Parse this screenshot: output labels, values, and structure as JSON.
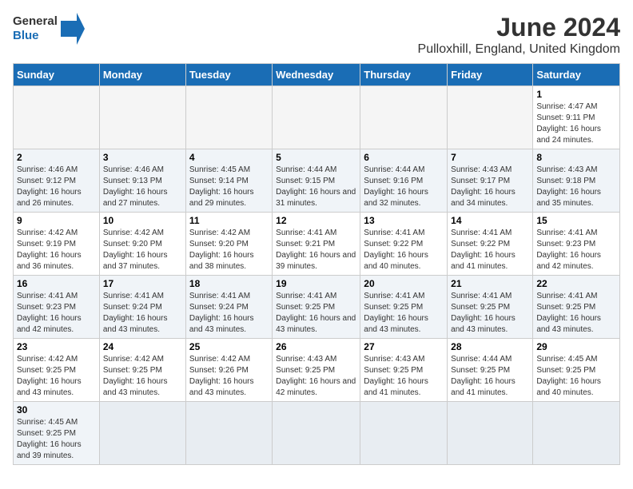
{
  "header": {
    "logo_general": "General",
    "logo_blue": "Blue",
    "month_year": "June 2024",
    "location": "Pulloxhill, England, United Kingdom"
  },
  "days_of_week": [
    "Sunday",
    "Monday",
    "Tuesday",
    "Wednesday",
    "Thursday",
    "Friday",
    "Saturday"
  ],
  "weeks": [
    [
      {
        "day": "",
        "info": ""
      },
      {
        "day": "",
        "info": ""
      },
      {
        "day": "",
        "info": ""
      },
      {
        "day": "",
        "info": ""
      },
      {
        "day": "",
        "info": ""
      },
      {
        "day": "",
        "info": ""
      },
      {
        "day": "1",
        "info": "Sunrise: 4:47 AM\nSunset: 9:11 PM\nDaylight: 16 hours and 24 minutes."
      }
    ],
    [
      {
        "day": "2",
        "info": "Sunrise: 4:46 AM\nSunset: 9:12 PM\nDaylight: 16 hours and 26 minutes."
      },
      {
        "day": "3",
        "info": "Sunrise: 4:46 AM\nSunset: 9:13 PM\nDaylight: 16 hours and 27 minutes."
      },
      {
        "day": "4",
        "info": "Sunrise: 4:45 AM\nSunset: 9:14 PM\nDaylight: 16 hours and 29 minutes."
      },
      {
        "day": "5",
        "info": "Sunrise: 4:44 AM\nSunset: 9:15 PM\nDaylight: 16 hours and 31 minutes."
      },
      {
        "day": "6",
        "info": "Sunrise: 4:44 AM\nSunset: 9:16 PM\nDaylight: 16 hours and 32 minutes."
      },
      {
        "day": "7",
        "info": "Sunrise: 4:43 AM\nSunset: 9:17 PM\nDaylight: 16 hours and 34 minutes."
      },
      {
        "day": "8",
        "info": "Sunrise: 4:43 AM\nSunset: 9:18 PM\nDaylight: 16 hours and 35 minutes."
      }
    ],
    [
      {
        "day": "9",
        "info": "Sunrise: 4:42 AM\nSunset: 9:19 PM\nDaylight: 16 hours and 36 minutes."
      },
      {
        "day": "10",
        "info": "Sunrise: 4:42 AM\nSunset: 9:20 PM\nDaylight: 16 hours and 37 minutes."
      },
      {
        "day": "11",
        "info": "Sunrise: 4:42 AM\nSunset: 9:20 PM\nDaylight: 16 hours and 38 minutes."
      },
      {
        "day": "12",
        "info": "Sunrise: 4:41 AM\nSunset: 9:21 PM\nDaylight: 16 hours and 39 minutes."
      },
      {
        "day": "13",
        "info": "Sunrise: 4:41 AM\nSunset: 9:22 PM\nDaylight: 16 hours and 40 minutes."
      },
      {
        "day": "14",
        "info": "Sunrise: 4:41 AM\nSunset: 9:22 PM\nDaylight: 16 hours and 41 minutes."
      },
      {
        "day": "15",
        "info": "Sunrise: 4:41 AM\nSunset: 9:23 PM\nDaylight: 16 hours and 42 minutes."
      }
    ],
    [
      {
        "day": "16",
        "info": "Sunrise: 4:41 AM\nSunset: 9:23 PM\nDaylight: 16 hours and 42 minutes."
      },
      {
        "day": "17",
        "info": "Sunrise: 4:41 AM\nSunset: 9:24 PM\nDaylight: 16 hours and 43 minutes."
      },
      {
        "day": "18",
        "info": "Sunrise: 4:41 AM\nSunset: 9:24 PM\nDaylight: 16 hours and 43 minutes."
      },
      {
        "day": "19",
        "info": "Sunrise: 4:41 AM\nSunset: 9:25 PM\nDaylight: 16 hours and 43 minutes."
      },
      {
        "day": "20",
        "info": "Sunrise: 4:41 AM\nSunset: 9:25 PM\nDaylight: 16 hours and 43 minutes."
      },
      {
        "day": "21",
        "info": "Sunrise: 4:41 AM\nSunset: 9:25 PM\nDaylight: 16 hours and 43 minutes."
      },
      {
        "day": "22",
        "info": "Sunrise: 4:41 AM\nSunset: 9:25 PM\nDaylight: 16 hours and 43 minutes."
      }
    ],
    [
      {
        "day": "23",
        "info": "Sunrise: 4:42 AM\nSunset: 9:25 PM\nDaylight: 16 hours and 43 minutes."
      },
      {
        "day": "24",
        "info": "Sunrise: 4:42 AM\nSunset: 9:25 PM\nDaylight: 16 hours and 43 minutes."
      },
      {
        "day": "25",
        "info": "Sunrise: 4:42 AM\nSunset: 9:26 PM\nDaylight: 16 hours and 43 minutes."
      },
      {
        "day": "26",
        "info": "Sunrise: 4:43 AM\nSunset: 9:25 PM\nDaylight: 16 hours and 42 minutes."
      },
      {
        "day": "27",
        "info": "Sunrise: 4:43 AM\nSunset: 9:25 PM\nDaylight: 16 hours and 41 minutes."
      },
      {
        "day": "28",
        "info": "Sunrise: 4:44 AM\nSunset: 9:25 PM\nDaylight: 16 hours and 41 minutes."
      },
      {
        "day": "29",
        "info": "Sunrise: 4:45 AM\nSunset: 9:25 PM\nDaylight: 16 hours and 40 minutes."
      }
    ],
    [
      {
        "day": "30",
        "info": "Sunrise: 4:45 AM\nSunset: 9:25 PM\nDaylight: 16 hours and 39 minutes."
      },
      {
        "day": "",
        "info": ""
      },
      {
        "day": "",
        "info": ""
      },
      {
        "day": "",
        "info": ""
      },
      {
        "day": "",
        "info": ""
      },
      {
        "day": "",
        "info": ""
      },
      {
        "day": "",
        "info": ""
      }
    ]
  ]
}
